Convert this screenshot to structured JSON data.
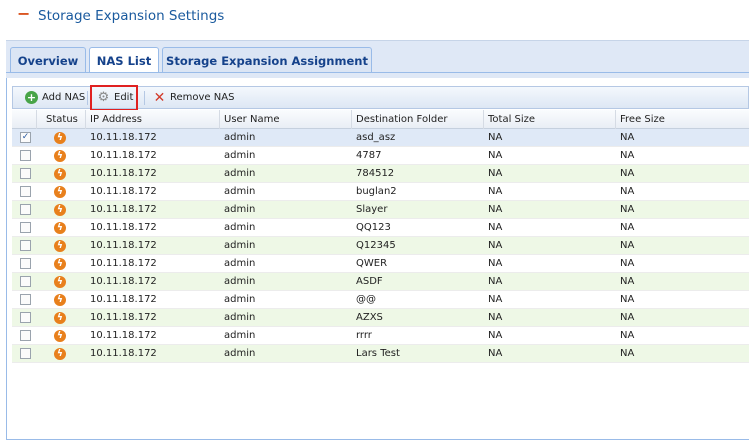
{
  "section": {
    "toggle": "−",
    "title": "Storage Expansion Settings"
  },
  "tabs": [
    {
      "label": "Overview",
      "active": false
    },
    {
      "label": "NAS List",
      "active": true
    },
    {
      "label": "Storage Expansion Assignment",
      "active": false
    }
  ],
  "toolbar": {
    "add_label": "Add NAS",
    "edit_label": "Edit",
    "remove_label": "Remove NAS"
  },
  "grid": {
    "columns": [
      "Status",
      "IP Address",
      "User Name",
      "Destination Folder",
      "Total Size",
      "Free Size"
    ],
    "rows": [
      {
        "checked": true,
        "ip": "10.11.18.172",
        "user": "admin",
        "folder": "asd_asz",
        "total": "NA",
        "free": "NA"
      },
      {
        "checked": false,
        "ip": "10.11.18.172",
        "user": "admin",
        "folder": "4787",
        "total": "NA",
        "free": "NA"
      },
      {
        "checked": false,
        "ip": "10.11.18.172",
        "user": "admin",
        "folder": "784512",
        "total": "NA",
        "free": "NA"
      },
      {
        "checked": false,
        "ip": "10.11.18.172",
        "user": "admin",
        "folder": "buglan2",
        "total": "NA",
        "free": "NA"
      },
      {
        "checked": false,
        "ip": "10.11.18.172",
        "user": "admin",
        "folder": "Slayer",
        "total": "NA",
        "free": "NA"
      },
      {
        "checked": false,
        "ip": "10.11.18.172",
        "user": "admin",
        "folder": "QQ123",
        "total": "NA",
        "free": "NA"
      },
      {
        "checked": false,
        "ip": "10.11.18.172",
        "user": "admin",
        "folder": "Q12345",
        "total": "NA",
        "free": "NA"
      },
      {
        "checked": false,
        "ip": "10.11.18.172",
        "user": "admin",
        "folder": "QWER",
        "total": "NA",
        "free": "NA"
      },
      {
        "checked": false,
        "ip": "10.11.18.172",
        "user": "admin",
        "folder": "ASDF",
        "total": "NA",
        "free": "NA"
      },
      {
        "checked": false,
        "ip": "10.11.18.172",
        "user": "admin",
        "folder": "@@",
        "total": "NA",
        "free": "NA"
      },
      {
        "checked": false,
        "ip": "10.11.18.172",
        "user": "admin",
        "folder": "AZXS",
        "total": "NA",
        "free": "NA"
      },
      {
        "checked": false,
        "ip": "10.11.18.172",
        "user": "admin",
        "folder": "rrrr",
        "total": "NA",
        "free": "NA"
      },
      {
        "checked": false,
        "ip": "10.11.18.172",
        "user": "admin",
        "folder": "Lars Test",
        "total": "NA",
        "free": "NA"
      }
    ]
  },
  "icons": {
    "collapse": "minus-icon",
    "add": "add-circle-icon",
    "edit": "gear-icon",
    "remove": "remove-x-icon",
    "status": "status-lightning-icon"
  },
  "colors": {
    "accent_title": "#1a5a9e",
    "tab_text": "#15428b",
    "row_alt": "#eef8e6",
    "highlight_box": "#e02020",
    "status_icon": "#e8801c"
  }
}
